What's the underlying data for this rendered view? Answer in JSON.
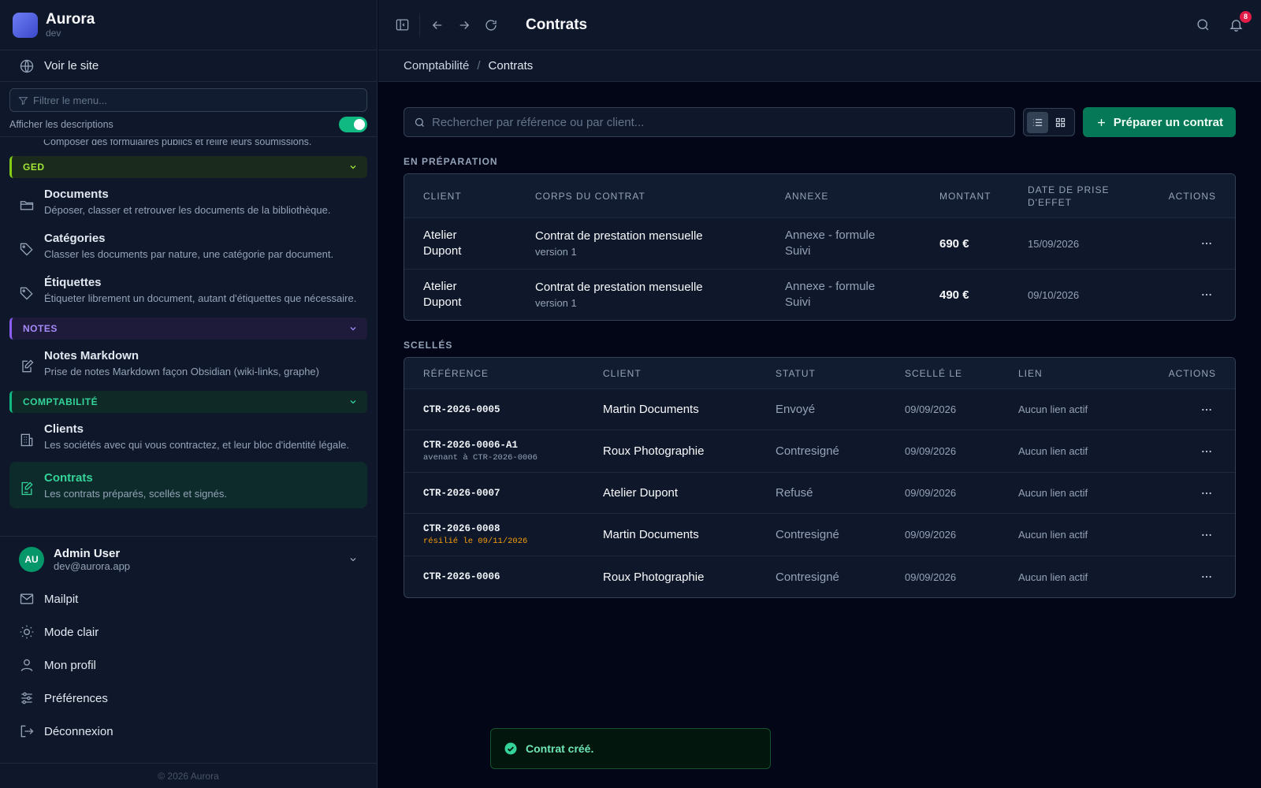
{
  "app": {
    "name": "Aurora",
    "env": "dev"
  },
  "sidebar": {
    "site_link": "Voir le site",
    "filter_placeholder": "Filtrer le menu...",
    "show_descriptions": "Afficher les descriptions",
    "cut_item_desc": "Composer des formulaires publics et relire leurs soumissions.",
    "groups": {
      "ged": {
        "label": "GED",
        "items": [
          {
            "title": "Documents",
            "desc": "Déposer, classer et retrouver les documents de la bibliothèque."
          },
          {
            "title": "Catégories",
            "desc": "Classer les documents par nature, une catégorie par document."
          },
          {
            "title": "Étiquettes",
            "desc": "Étiqueter librement un document, autant d'étiquettes que nécessaire."
          }
        ]
      },
      "notes": {
        "label": "NOTES",
        "items": [
          {
            "title": "Notes Markdown",
            "desc": "Prise de notes Markdown façon Obsidian (wiki-links, graphe)"
          }
        ]
      },
      "compta": {
        "label": "COMPTABILITÉ",
        "items": [
          {
            "title": "Clients",
            "desc": "Les sociétés avec qui vous contractez, et leur bloc d'identité légale."
          },
          {
            "title": "Contrats",
            "desc": "Les contrats préparés, scellés et signés."
          }
        ]
      }
    },
    "user": {
      "initials": "AU",
      "name": "Admin User",
      "email": "dev@aurora.app"
    },
    "links": [
      "Mailpit",
      "Mode clair",
      "Mon profil",
      "Préférences",
      "Déconnexion"
    ],
    "copyright": "© 2026 Aurora"
  },
  "topbar": {
    "title": "Contrats",
    "notification_count": "8"
  },
  "breadcrumb": {
    "parent": "Comptabilité",
    "separator": "/",
    "current": "Contrats"
  },
  "toolbar": {
    "search_placeholder": "Rechercher par référence ou par client...",
    "primary_label": "Préparer un contrat"
  },
  "draft": {
    "label": "EN PRÉPARATION",
    "headers": [
      "CLIENT",
      "CORPS DU CONTRAT",
      "ANNEXE",
      "MONTANT",
      "DATE DE PRISE D'EFFET",
      "ACTIONS"
    ],
    "rows": [
      {
        "client": "Atelier Dupont",
        "body": "Contrat de prestation mensuelle",
        "version": "version 1",
        "annex": "Annexe - formule Suivi",
        "amount": "690 €",
        "date": "15/09/2026"
      },
      {
        "client": "Atelier Dupont",
        "body": "Contrat de prestation mensuelle",
        "version": "version 1",
        "annex": "Annexe - formule Suivi",
        "amount": "490 €",
        "date": "09/10/2026"
      }
    ]
  },
  "sealed": {
    "label": "SCELLÉS",
    "headers": [
      "RÉFÉRENCE",
      "CLIENT",
      "STATUT",
      "SCELLÉ LE",
      "LIEN",
      "ACTIONS"
    ],
    "rows": [
      {
        "ref": "CTR-2026-0005",
        "note": "",
        "client": "Martin Documents",
        "status": "Envoyé",
        "sealed": "09/09/2026",
        "link": "Aucun lien actif"
      },
      {
        "ref": "CTR-2026-0006-A1",
        "note": "avenant à CTR-2026-0006",
        "client": "Roux Photographie",
        "status": "Contresigné",
        "sealed": "09/09/2026",
        "link": "Aucun lien actif"
      },
      {
        "ref": "CTR-2026-0007",
        "note": "",
        "client": "Atelier Dupont",
        "status": "Refusé",
        "sealed": "09/09/2026",
        "link": "Aucun lien actif"
      },
      {
        "ref": "CTR-2026-0008",
        "note": "résilié le 09/11/2026",
        "client": "Martin Documents",
        "status": "Contresigné",
        "sealed": "09/09/2026",
        "link": "Aucun lien actif"
      },
      {
        "ref": "CTR-2026-0006",
        "note": "",
        "client": "Roux Photographie",
        "status": "Contresigné",
        "sealed": "09/09/2026",
        "link": "Aucun lien actif"
      }
    ]
  },
  "toast": {
    "message": "Contrat créé."
  },
  "colors": {
    "accent": "#047857",
    "ged": "#84cc16",
    "notes": "#8b5cf6",
    "compta": "#10b981",
    "warning": "#f59e0b"
  }
}
